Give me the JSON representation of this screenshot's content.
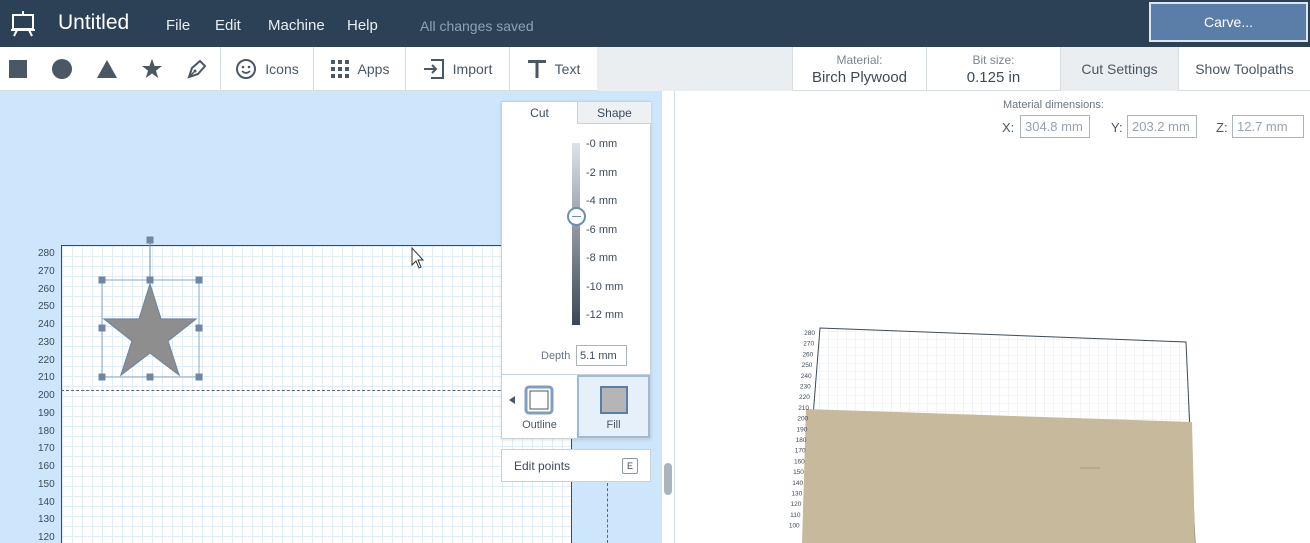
{
  "header": {
    "title": "Untitled",
    "menu": [
      "File",
      "Edit",
      "Machine",
      "Help"
    ],
    "save_status": "All changes saved",
    "carve_label": "Carve..."
  },
  "toolbar": {
    "icons_label": "Icons",
    "apps_label": "Apps",
    "import_label": "Import",
    "text_label": "Text",
    "material_caption": "Material:",
    "material_value": "Birch Plywood",
    "bit_caption": "Bit size:",
    "bit_value": "0.125 in",
    "cut_settings": "Cut Settings",
    "show_toolpaths": "Show Toolpaths"
  },
  "canvas": {
    "y_ticks": [
      "280",
      "270",
      "260",
      "250",
      "240",
      "230",
      "220",
      "210",
      "200",
      "190",
      "180",
      "170",
      "160",
      "150",
      "140",
      "130",
      "120"
    ]
  },
  "shape_panel": {
    "tab_cut": "Cut",
    "tab_shape": "Shape",
    "depth_scale": [
      "-0 mm",
      "-2 mm",
      "-4 mm",
      "-6 mm",
      "-8 mm",
      "-10 mm",
      "-12 mm"
    ],
    "depth_label": "Depth",
    "depth_value": "5.1 mm",
    "outline_label": "Outline",
    "fill_label": "Fill",
    "edit_points_label": "Edit points",
    "edit_points_key": "E"
  },
  "preview": {
    "dimensions_title": "Material dimensions:",
    "x_label": "X:",
    "x_value": "304.8 mm",
    "y_label": "Y:",
    "y_value": "203.2 mm",
    "z_label": "Z:",
    "z_value": "12.7 mm",
    "y_ticks": [
      "280",
      "270",
      "260",
      "250",
      "240",
      "230",
      "220",
      "210",
      "200",
      "190",
      "180",
      "170",
      "160",
      "150",
      "140",
      "130",
      "120",
      "110",
      "100"
    ]
  },
  "colors": {
    "topbar": "#2d4156",
    "carve_button": "#5a7ea8",
    "canvas_bg": "#cde6fb",
    "star_fill": "#8e8e8e",
    "material_wood": "#c6b99c"
  }
}
